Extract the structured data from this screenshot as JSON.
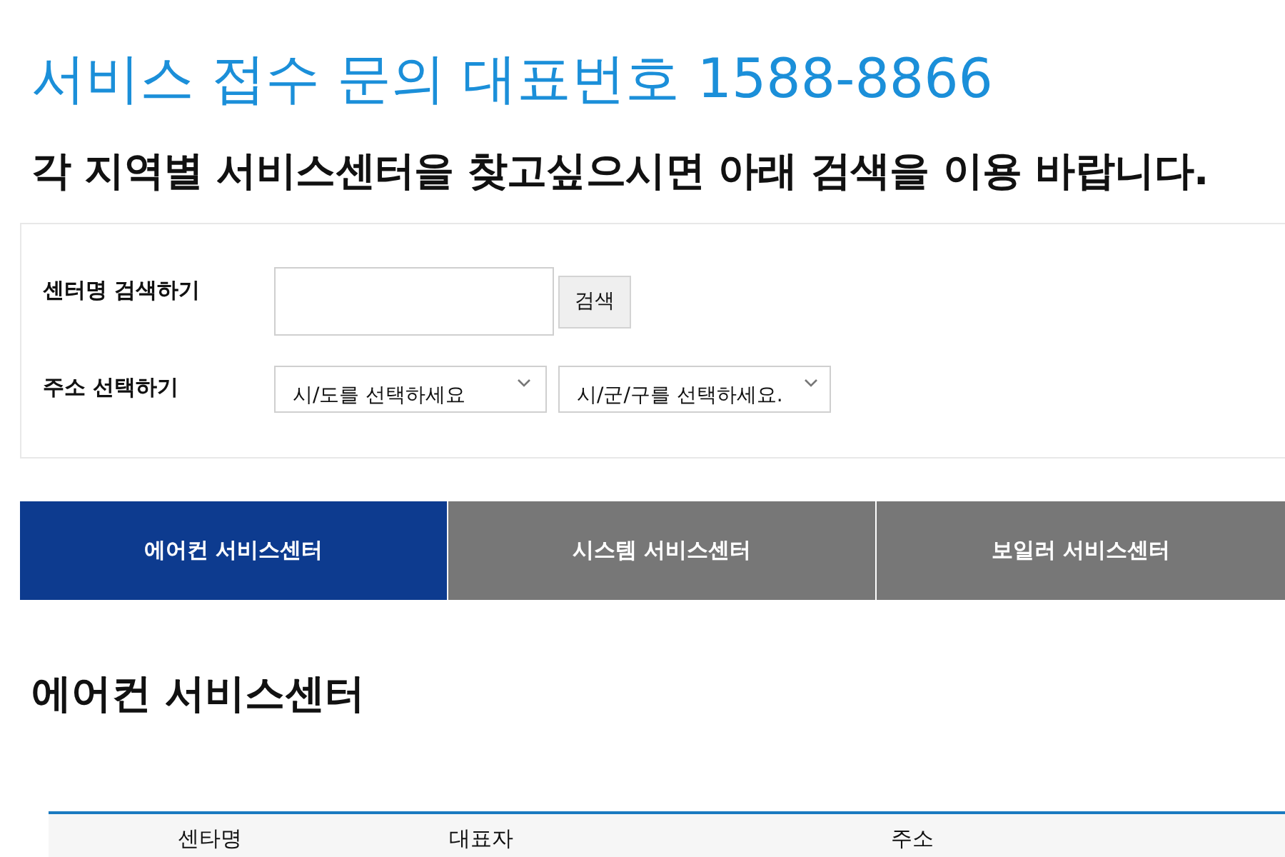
{
  "title": "서비스 접수 문의 대표번호 1588-8866",
  "subtitle": "각 지역별 서비스센터을 찾고싶으시면 아래 검색을 이용 바랍니다.",
  "search_panel": {
    "name_search": {
      "label": "센터명 검색하기",
      "button": "검색"
    },
    "address_select": {
      "label": "주소 선택하기",
      "selects": [
        {
          "placeholder": "시/도를 선택하세요"
        },
        {
          "placeholder": "시/군/구를 선택하세요."
        }
      ]
    }
  },
  "tabs": [
    {
      "label": "에어컨 서비스센터",
      "selected": true
    },
    {
      "label": "시스템 서비스센터",
      "selected": false
    },
    {
      "label": "보일러 서비스센터",
      "selected": false
    }
  ],
  "section_title": "에어컨 서비스센터",
  "table": {
    "columns": [
      "센타명",
      "대표자",
      "주소"
    ]
  }
}
